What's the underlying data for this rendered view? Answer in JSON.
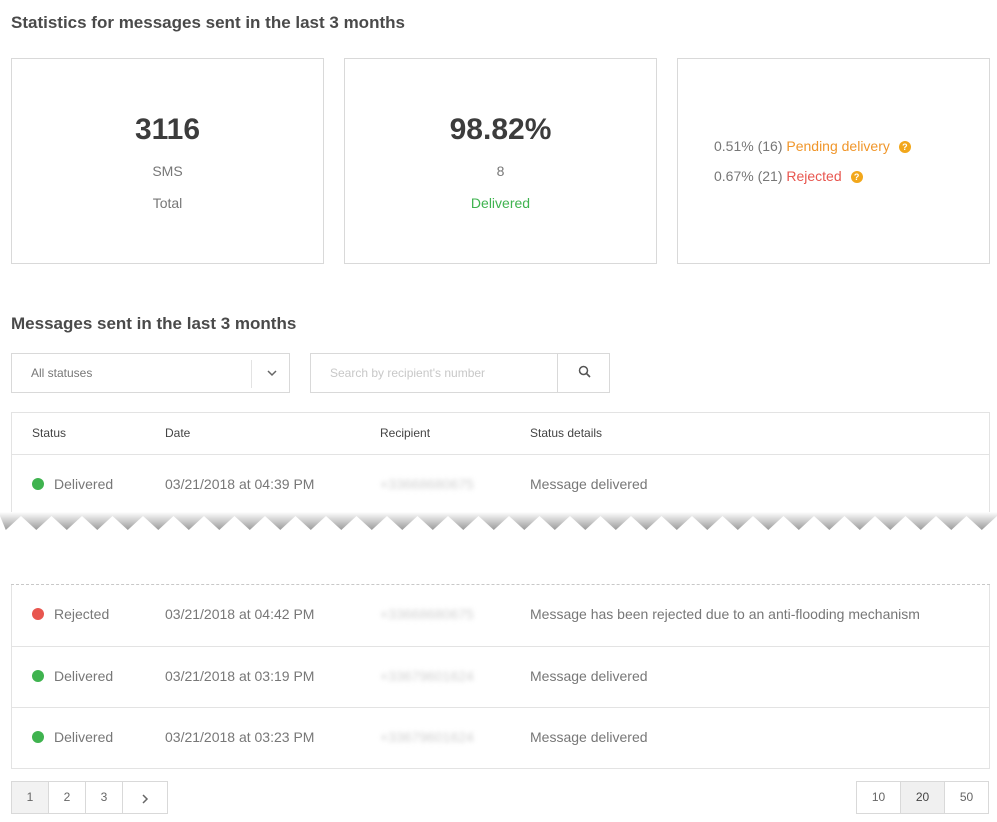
{
  "stats": {
    "title": "Statistics for messages sent in the last 3 months",
    "total": {
      "value": "3116",
      "unit": "SMS",
      "label": "Total"
    },
    "delivered": {
      "value": "98.82%",
      "count": "8",
      "label": "Delivered"
    },
    "pending": {
      "text": "0.51% (16)",
      "label": "Pending delivery"
    },
    "rejected": {
      "text": "0.67% (21)",
      "label": "Rejected"
    }
  },
  "messages": {
    "title": "Messages sent in the last 3 months",
    "status_filter": "All statuses",
    "search_placeholder": "Search by recipient's number",
    "columns": {
      "status": "Status",
      "date": "Date",
      "recipient": "Recipient",
      "details": "Status details"
    },
    "rows": [
      {
        "status": "Delivered",
        "date": "03/21/2018 at 04:39 PM",
        "recipient": "+33668680675",
        "details": "Message delivered"
      },
      {
        "status": "Rejected",
        "date": "03/21/2018 at 04:42 PM",
        "recipient": "+33668680675",
        "details": "Message has been rejected due to an anti-flooding mechanism"
      },
      {
        "status": "Delivered",
        "date": "03/21/2018 at 03:19 PM",
        "recipient": "+33679601624",
        "details": "Message delivered"
      },
      {
        "status": "Delivered",
        "date": "03/21/2018 at 03:23 PM",
        "recipient": "+33679601624",
        "details": "Message delivered"
      }
    ]
  },
  "pagination": {
    "pages": [
      "1",
      "2",
      "3"
    ],
    "current": "1"
  },
  "page_sizes": {
    "options": [
      "10",
      "20",
      "50"
    ],
    "selected": "20"
  },
  "colors": {
    "delivered": "#3fb34f",
    "pending": "#f0962a",
    "rejected": "#e8564f",
    "help_badge": "#f2a71b"
  },
  "icons": {
    "dropdown": "chevron-down-icon",
    "search": "search-icon",
    "next": "chevron-right-icon",
    "help": "help-icon"
  }
}
